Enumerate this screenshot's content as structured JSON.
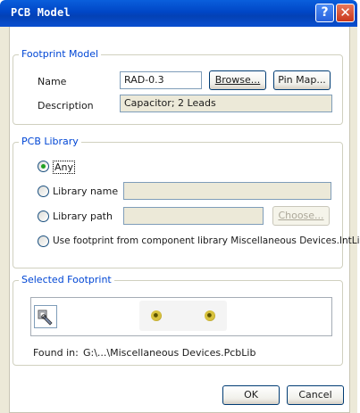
{
  "window": {
    "title": "PCB Model",
    "help_glyph": "?",
    "close_glyph": "✕"
  },
  "footprint_model": {
    "group_label": "Footprint Model",
    "name_label": "Name",
    "name_value": "RAD-0.3",
    "browse_label": "Browse...",
    "pinmap_label": "Pin Map...",
    "description_label": "Description",
    "description_value": "Capacitor; 2 Leads"
  },
  "pcb_library": {
    "group_label": "PCB Library",
    "options": {
      "any": "Any",
      "library_name": "Library name",
      "library_path": "Library path",
      "use_component_library": "Use footprint from component library Miscellaneous Devices.IntLib"
    },
    "selected_option": "any",
    "library_name_value": "",
    "library_path_value": "",
    "choose_label": "Choose..."
  },
  "selected_footprint": {
    "group_label": "Selected Footprint",
    "found_in_label": "Found in:",
    "found_in_value": "G:\\...\\Miscellaneous Devices.PcbLib",
    "icon": "pcb-component-wrench-icon",
    "preview_pad_color": "#d7c13d"
  },
  "footer": {
    "ok_label": "OK",
    "cancel_label": "Cancel"
  }
}
